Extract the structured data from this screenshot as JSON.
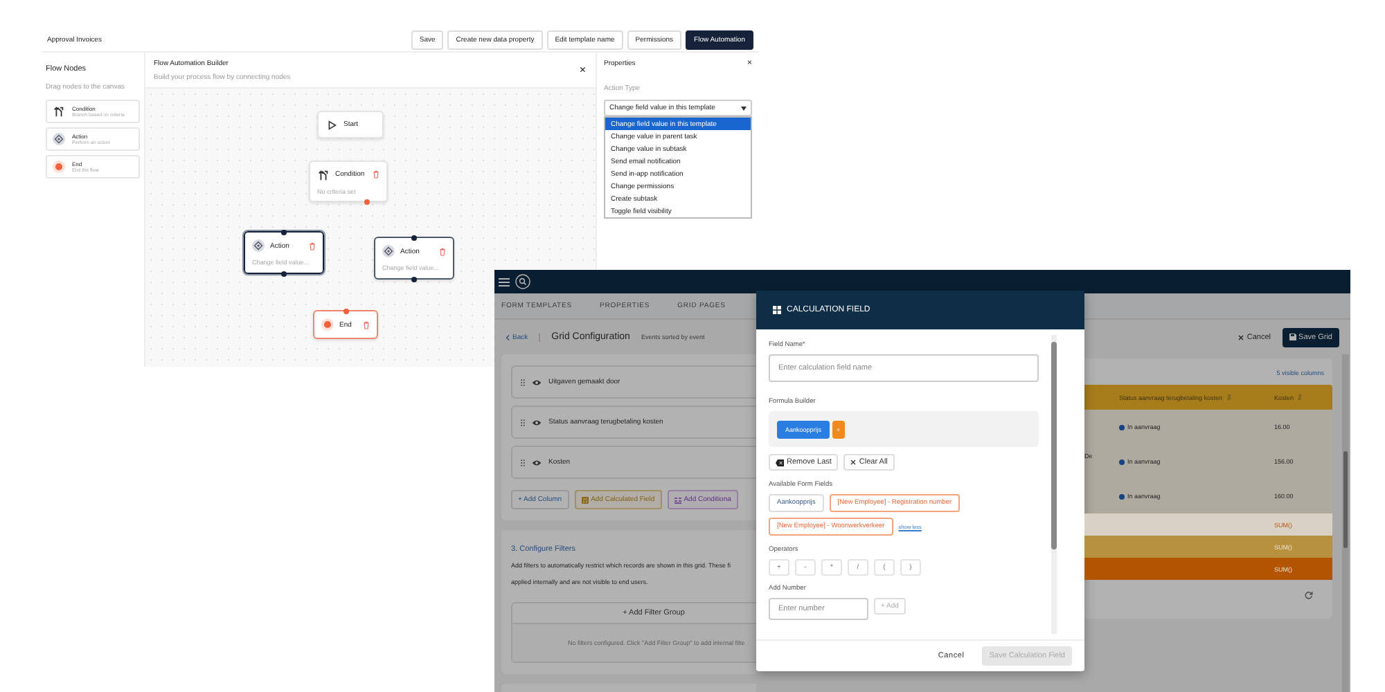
{
  "flow_editor": {
    "title": "Approval Invoices",
    "toolbar": [
      {
        "label": "Save",
        "selected": false
      },
      {
        "label": "Create new data property",
        "selected": false
      },
      {
        "label": "Edit template name",
        "selected": false
      },
      {
        "label": "Permissions",
        "selected": false
      },
      {
        "label": "Flow Automation",
        "selected": true
      }
    ],
    "nodes_panel": {
      "title": "Flow Nodes",
      "hint": "Drag nodes to the canvas",
      "items": [
        {
          "kind": "condition",
          "label": "Condition",
          "description": "Branch based on criteria"
        },
        {
          "kind": "action",
          "label": "Action",
          "description": "Perform an action"
        },
        {
          "kind": "end",
          "label": "End",
          "description": "End the flow"
        }
      ]
    },
    "builder": {
      "title": "Flow Automation Builder",
      "subtitle": "Build your process flow by connecting nodes",
      "close": "×",
      "nodes": [
        {
          "kind": "start",
          "label": "Start",
          "selected": false
        },
        {
          "kind": "condition",
          "label": "Condition",
          "detail": "No criteria set",
          "selected": false
        },
        {
          "kind": "action",
          "label": "Action",
          "detail": "Change field value...",
          "selected": true
        },
        {
          "kind": "action",
          "label": "Action",
          "detail": "Change field value...",
          "selected": false
        },
        {
          "kind": "end",
          "label": "End",
          "selected": false
        }
      ]
    },
    "properties": {
      "title": "Properties",
      "close": "×",
      "field_label": "Action Type",
      "value": "Change field value in this template",
      "options": [
        {
          "label": "Change field value in this template",
          "selected": true
        },
        {
          "label": "Change value in parent task",
          "selected": false
        },
        {
          "label": "Change value in subtask",
          "selected": false
        },
        {
          "label": "Send email notification",
          "selected": false
        },
        {
          "label": "Send in-app notification",
          "selected": false
        },
        {
          "label": "Change permissions",
          "selected": false
        },
        {
          "label": "Create subtask",
          "selected": false
        },
        {
          "label": "Toggle field visibility",
          "selected": false
        }
      ]
    }
  },
  "grid_app": {
    "tabs": [
      {
        "label": "FORM TEMPLATES",
        "selected": false
      },
      {
        "label": "PROPERTIES",
        "selected": false
      },
      {
        "label": "GRID PAGES",
        "selected": false
      }
    ],
    "back": "Back",
    "title": "Grid Configuration",
    "subtitle": "Events sorted by event",
    "cancel": "Cancel",
    "save": "Save Grid",
    "columns": [
      {
        "label": "Uitgaven gemaakt door",
        "visible": true
      },
      {
        "label": "Status aanvraag terugbetaling kosten",
        "visible": true
      },
      {
        "label": "Kosten",
        "visible": true
      }
    ],
    "column_actions": [
      {
        "kind": "column",
        "label": "+ Add Column"
      },
      {
        "kind": "calculated",
        "label": "Add Calculated Field"
      },
      {
        "kind": "conditional",
        "label": "Add Conditiona"
      }
    ],
    "filters": {
      "title": "3. Configure Filters",
      "description_lines": [
        "Add filters to automatically restrict which records are shown in this grid. These fi",
        "applied internally and are not visible to end users."
      ],
      "add_group": "+ Add Filter Group",
      "empty": "No filters configured. Click \"Add Filter Group\" to add internal filte"
    },
    "table": {
      "visible_columns": "5 visible columns",
      "columns": [
        "Status aanvraag terugbetaling kosten",
        "Kosten"
      ],
      "rows": [
        {
          "kind": "data",
          "status": "In aanvraag",
          "amount": "16.00"
        },
        {
          "kind": "data",
          "column_1": "De",
          "status": "In aanvraag",
          "amount": "156.00"
        },
        {
          "kind": "data",
          "status": "In aanvraag",
          "amount": "160.00"
        },
        {
          "kind": "sum",
          "color": "#d9d1c3",
          "amount": "SUM()"
        },
        {
          "kind": "sum",
          "color": "#b8913f",
          "amount": "SUM()"
        },
        {
          "kind": "sum",
          "color": "#b35400",
          "amount": "SUM()"
        }
      ]
    }
  },
  "calculation_modal": {
    "title": "CALCULATION FIELD",
    "field_name_label": "Field Name*",
    "field_name_placeholder": "Enter calculation field name",
    "formula_label": "Formula Builder",
    "formula": [
      {
        "kind": "field",
        "label": "Aankoopprijs"
      },
      {
        "kind": "operator",
        "label": "+"
      }
    ],
    "remove_last": "Remove Last",
    "clear_all": "Clear All",
    "fields_label": "Available Form Fields",
    "fields": [
      {
        "label": "Aankoopprijs",
        "highlighted": false
      },
      {
        "label": "[New Employee] - Registration number",
        "highlighted": true
      },
      {
        "label": "[New Employee] - Woonwerkverkeer",
        "highlighted": true
      }
    ],
    "show_less": "show less",
    "operators_label": "Operators",
    "operators": [
      "+",
      "-",
      "*",
      "/",
      "(",
      ")"
    ],
    "number_label": "Add Number",
    "number_placeholder": "Enter number",
    "add": {
      "label": "+ Add",
      "disabled": true
    },
    "cancel": "Cancel",
    "save": {
      "label": "Save Calculation Field",
      "disabled": true
    }
  }
}
